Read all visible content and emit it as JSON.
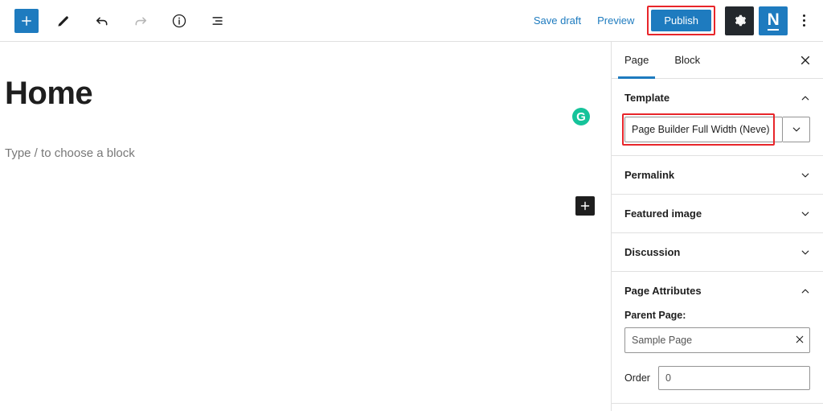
{
  "header": {
    "add_block_icon": "plus-icon",
    "edit_icon": "pencil-icon",
    "undo_icon": "undo-arrow-icon",
    "redo_icon": "redo-arrow-icon",
    "info_icon": "info-circle-icon",
    "list_view_icon": "list-view-icon",
    "save_draft_label": "Save draft",
    "preview_label": "Preview",
    "publish_label": "Publish",
    "settings_icon": "gear-icon",
    "neve_logo_label": "N",
    "more_menu_icon": "kebab-menu-icon",
    "publish_highlight_color": "#e8252a",
    "accent_color": "#1e7bbf"
  },
  "editor": {
    "title": "Home",
    "block_placeholder": "Type / to choose a block",
    "grammarly_icon_label": "G",
    "grammarly_color": "#15c39a",
    "inline_add_icon": "plus-icon"
  },
  "sidebar": {
    "tabs": [
      {
        "label": "Page",
        "active": true
      },
      {
        "label": "Block",
        "active": false
      }
    ],
    "close_icon": "close-icon",
    "panels": [
      {
        "title": "Template",
        "expanded": true
      },
      {
        "title": "Permalink",
        "expanded": false
      },
      {
        "title": "Featured image",
        "expanded": false
      },
      {
        "title": "Discussion",
        "expanded": false
      },
      {
        "title": "Page Attributes",
        "expanded": true
      }
    ],
    "template": {
      "selected": "Page Builder Full Width (Neve)",
      "highlight_color": "#e8252a"
    },
    "page_attributes": {
      "parent_label": "Parent Page:",
      "parent_value": "Sample Page",
      "parent_clear_icon": "close-icon",
      "order_label": "Order",
      "order_value": "0"
    }
  }
}
